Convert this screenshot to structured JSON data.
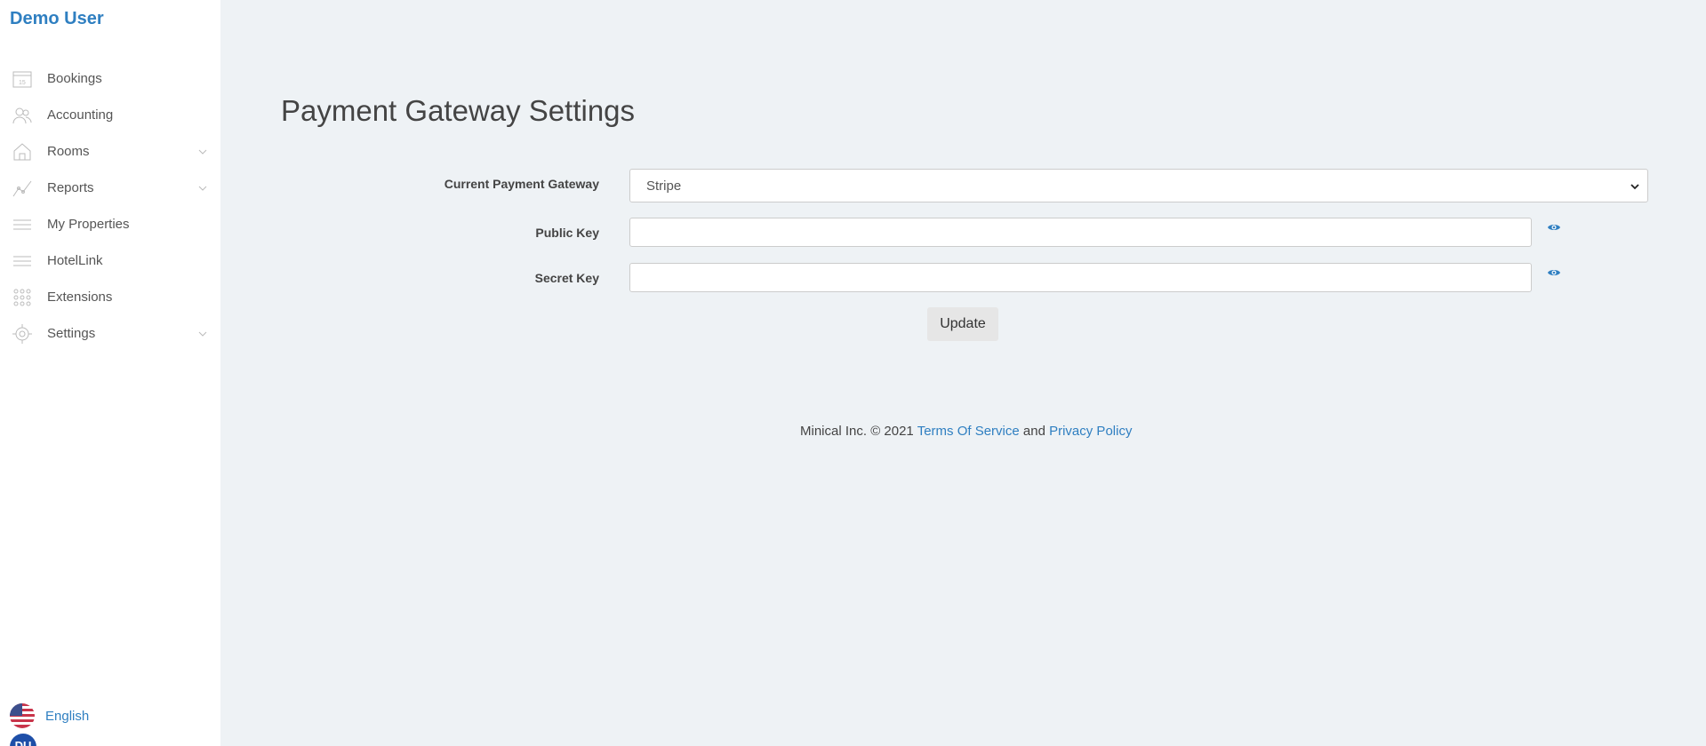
{
  "sidebar": {
    "brand": "Demo User",
    "items": [
      {
        "label": "Bookings",
        "icon": "calendar-icon",
        "has_chevron": false
      },
      {
        "label": "Accounting",
        "icon": "users-icon",
        "has_chevron": false
      },
      {
        "label": "Rooms",
        "icon": "home-icon",
        "has_chevron": true
      },
      {
        "label": "Reports",
        "icon": "chart-line-icon",
        "has_chevron": true
      },
      {
        "label": "My Properties",
        "icon": "list-icon",
        "has_chevron": false
      },
      {
        "label": "HotelLink",
        "icon": "list-icon",
        "has_chevron": false
      },
      {
        "label": "Extensions",
        "icon": "grid-icon",
        "has_chevron": false
      },
      {
        "label": "Settings",
        "icon": "gear-icon",
        "has_chevron": true
      }
    ],
    "language": {
      "label": "English",
      "icon": "us-flag-icon"
    },
    "avatar_initials": "DU"
  },
  "main": {
    "title": "Payment Gateway Settings",
    "gateway": {
      "label": "Current Payment Gateway",
      "selected": "Stripe"
    },
    "public_key": {
      "label": "Public Key",
      "value": ""
    },
    "secret_key": {
      "label": "Secret Key",
      "value": ""
    },
    "update_label": "Update"
  },
  "footer": {
    "prefix": "Minical Inc. © 2021",
    "terms": "Terms Of Service",
    "and": "and",
    "privacy": "Privacy Policy"
  },
  "colors": {
    "accent": "#2f7fc1",
    "background": "#eef2f5",
    "sidebar": "#ffffff"
  }
}
